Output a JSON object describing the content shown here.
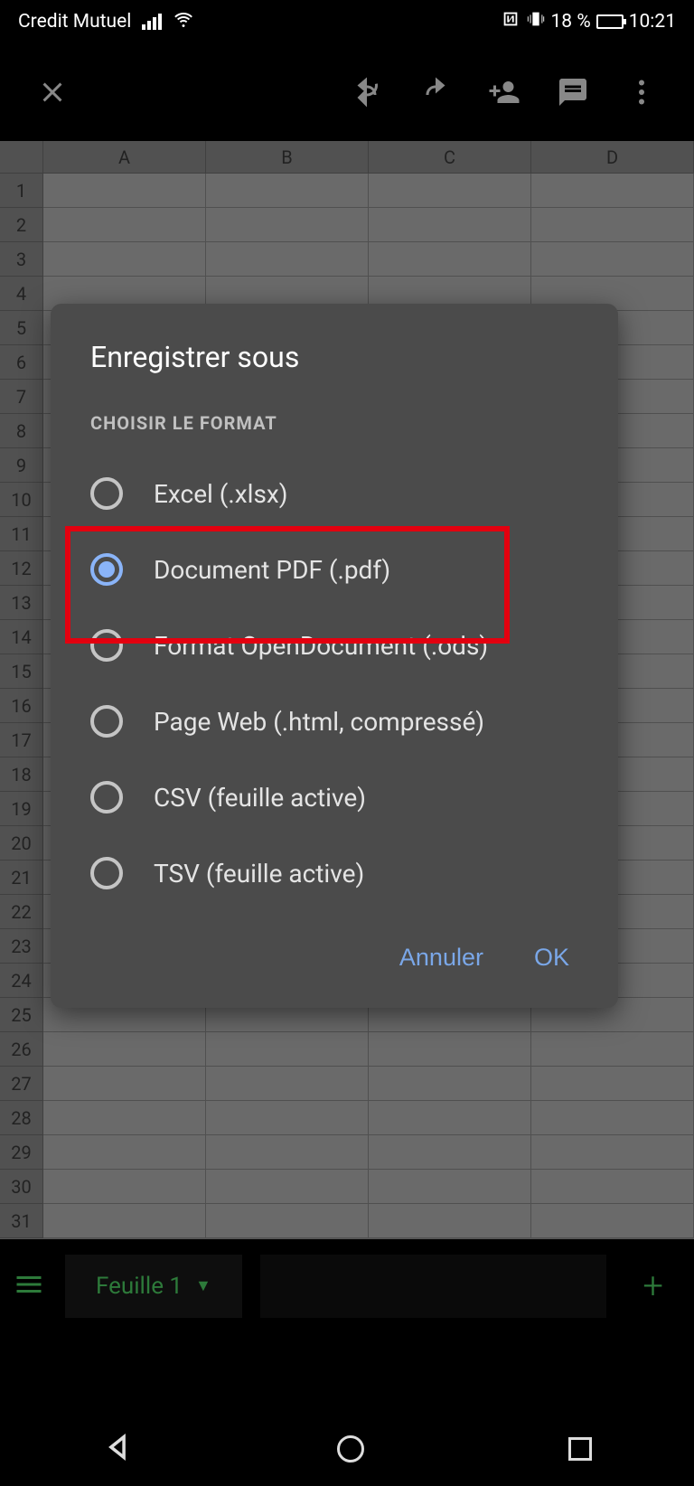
{
  "status_bar": {
    "carrier": "Credit Mutuel",
    "battery_percent": "18 %",
    "time": "10:21"
  },
  "spreadsheet": {
    "columns": [
      "A",
      "B",
      "C",
      "D"
    ],
    "row_count": 31
  },
  "sheet_tabs": {
    "active_tab": "Feuille 1"
  },
  "dialog": {
    "title": "Enregistrer sous",
    "section_heading": "CHOISIR LE FORMAT",
    "options": [
      {
        "label": "Excel (.xlsx)",
        "selected": false
      },
      {
        "label": "Document PDF (.pdf)",
        "selected": true
      },
      {
        "label": "Format OpenDocument (.ods)",
        "selected": false
      },
      {
        "label": "Page Web (.html, compressé)",
        "selected": false
      },
      {
        "label": "CSV (feuille active)",
        "selected": false
      },
      {
        "label": "TSV (feuille active)",
        "selected": false
      }
    ],
    "highlighted_index": 1,
    "cancel_label": "Annuler",
    "ok_label": "OK"
  }
}
